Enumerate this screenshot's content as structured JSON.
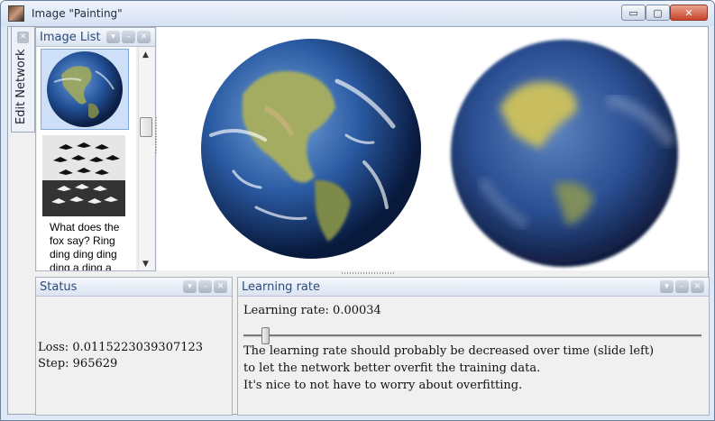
{
  "window": {
    "title": "Image \"Painting\"",
    "buttons": {
      "minimize": "▭",
      "maximize": "▢",
      "close": "✕"
    }
  },
  "side_tab": {
    "label": "Edit Network"
  },
  "image_list": {
    "title": "Image List",
    "items": [
      {
        "kind": "earth-photo",
        "selected": true
      },
      {
        "kind": "escher-birds",
        "selected": false
      },
      {
        "kind": "text",
        "text": "What does the fox say? Ring ding ding ding ding a ding a",
        "selected": false
      }
    ]
  },
  "status": {
    "title": "Status",
    "loss": "Loss: 0.0115223039307123",
    "step": "Step: 965629"
  },
  "learning_rate": {
    "title": "Learning rate",
    "label": "Learning rate: 0.00034",
    "slider_fraction": 0.04,
    "notes": [
      "The learning rate should probably be decreased over time (slide left)",
      "to let the network better overfit the training data.",
      "It's nice to not have to worry about overfitting."
    ]
  },
  "colors": {
    "panel_title": "#2c4a7a",
    "ocean": "#2b4f93",
    "land": "#9a9e5a"
  }
}
